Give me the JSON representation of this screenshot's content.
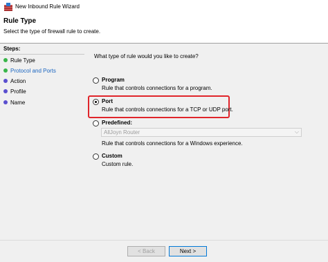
{
  "window": {
    "title": "New Inbound Rule Wizard"
  },
  "header": {
    "title": "Rule Type",
    "subtitle": "Select the type of firewall rule to create."
  },
  "steps": {
    "title": "Steps:",
    "items": [
      {
        "label": "Rule Type",
        "state": "current"
      },
      {
        "label": "Protocol and Ports",
        "state": "link"
      },
      {
        "label": "Action",
        "state": "todo"
      },
      {
        "label": "Profile",
        "state": "todo"
      },
      {
        "label": "Name",
        "state": "todo"
      }
    ]
  },
  "main": {
    "question": "What type of rule would you like to create?",
    "options": [
      {
        "label": "Program",
        "description": "Rule that controls connections for a program.",
        "selected": false
      },
      {
        "label": "Port",
        "description": "Rule that controls connections for a TCP or UDP port.",
        "selected": true
      },
      {
        "label": "Predefined:",
        "description": "Rule that controls connections for a Windows experience.",
        "selected": false
      },
      {
        "label": "Custom",
        "description": "Custom rule.",
        "selected": false
      }
    ],
    "predefined_select": {
      "value": "AllJoyn Router"
    }
  },
  "footer": {
    "back_label": "< Back",
    "next_label": "Next >"
  },
  "colors": {
    "highlight": "#e0242a",
    "step_done": "#3ab54a",
    "step_todo": "#5a4fcf",
    "link": "#1a65c0"
  }
}
